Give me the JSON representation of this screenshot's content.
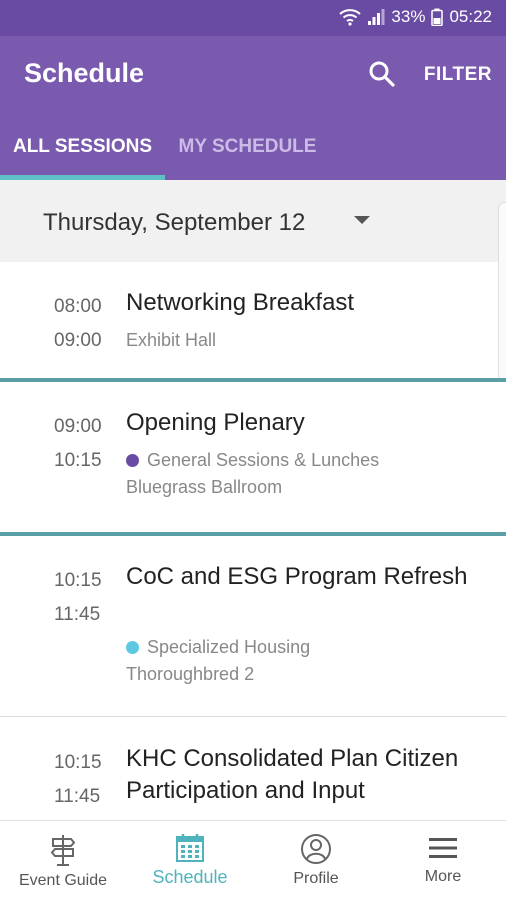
{
  "status_bar": {
    "battery_percent": "33%",
    "time": "05:22"
  },
  "app_bar": {
    "title": "Schedule",
    "filter_label": "FILTER",
    "search_icon": "search-icon"
  },
  "tabs": [
    {
      "label": "ALL SESSIONS",
      "active": true
    },
    {
      "label": "MY SCHEDULE",
      "active": false
    }
  ],
  "date_selector": {
    "label": "Thursday, September 12"
  },
  "sessions": [
    {
      "start": "08:00",
      "end": "09:00",
      "title": "Networking Breakfast",
      "track": "",
      "room": "Exhibit Hall"
    },
    {
      "start": "09:00",
      "end": "10:15",
      "title": "Opening Plenary",
      "track": "General Sessions & Lunches",
      "track_color": "#6a4ba3",
      "room": "Bluegrass Ballroom"
    },
    {
      "start": "10:15",
      "end": "11:45",
      "title": "CoC and ESG Program Refresh",
      "track": "Specialized Housing",
      "track_color": "#5ec8e0",
      "room": "Thoroughbred 2"
    },
    {
      "start": "10:15",
      "end": "11:45",
      "title": "KHC Consolidated Plan Citizen Participation and Input",
      "track": "",
      "room": ""
    }
  ],
  "bottom_nav": [
    {
      "label": "Event Guide",
      "icon": "signpost-icon",
      "active": false
    },
    {
      "label": "Schedule",
      "icon": "calendar-icon",
      "active": true
    },
    {
      "label": "Profile",
      "icon": "profile-icon",
      "active": false
    },
    {
      "label": "More",
      "icon": "menu-icon",
      "active": false
    }
  ],
  "colors": {
    "header": "#7a5aaf",
    "status_bar": "#6a4ba3",
    "accent_teal": "#4fb3bd"
  }
}
